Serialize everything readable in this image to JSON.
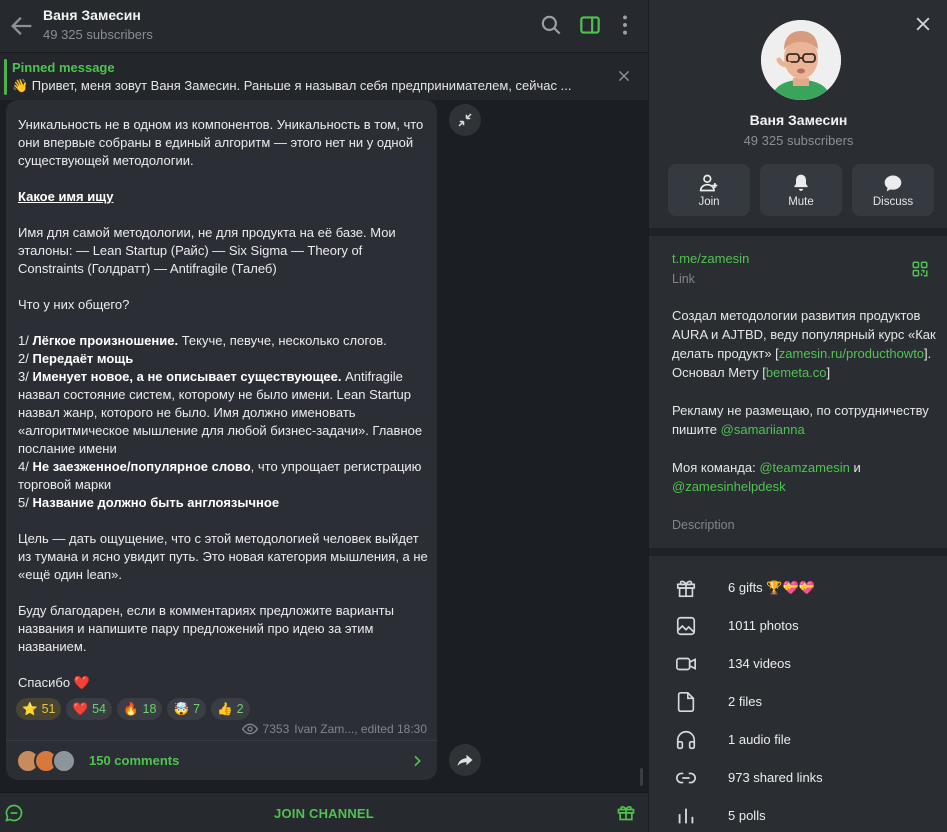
{
  "header": {
    "title": "Ваня Замесин",
    "subscribers": "49 325 subscribers"
  },
  "pinned": {
    "label": "Pinned message",
    "text": "👋 Привет, меня зовут Ваня Замесин. Раньше я называл себя предпринимателем, сейчас ..."
  },
  "message": {
    "p1": "Уникальность не в одном из компонентов. Уникальность в том, что они впервые собраны в единый алгоритм — этого нет ни у одной существующей методологии.",
    "h1": "Какое имя ищу",
    "p2": "Имя для самой методологии, не для продукта на её базе. Мои эталоны: — Lean Startup (Райс) — Six Sigma — Theory of Constraints (Голдратт) — Antifragile (Талеб)",
    "p3": "Что у них общего?",
    "l1a": "1/ ",
    "l1b": "Лёгкое произношение.",
    "l1c": " Текуче, певуче, несколько слогов.",
    "l2a": "2/ ",
    "l2b": "Передаёт мощь",
    "l3a": "3/ ",
    "l3b": "Именует новое, а не описывает существующее.",
    "l3c": " Antifragile назвал состояние систем, которому не было имени. Lean Startup назвал жанр, которого не было. Имя должно именовать «алгоритмическое мышление для любой бизнес-задачи». Главное послание имени",
    "l4a": "4/ ",
    "l4b": "Не заезженное/популярное слово",
    "l4c": ", что упрощает регистрацию торговой марки",
    "l5a": "5/ ",
    "l5b": "Название должно быть англоязычное",
    "p4": "Цель — дать ощущение, что с этой методологией человек выйдет из тумана и ясно увидит путь. Это новая категория мышления, а не «ещё один lean».",
    "p5": "Буду благодарен, если в комментариях предложите варианты названия и напишите пару предложений про идею за этим названием.",
    "p6": "Спасибо ❤️"
  },
  "reactions": [
    {
      "emoji": "⭐",
      "count": "51"
    },
    {
      "emoji": "❤️",
      "count": "54"
    },
    {
      "emoji": "🔥",
      "count": "18"
    },
    {
      "emoji": "🤯",
      "count": "7"
    },
    {
      "emoji": "👍",
      "count": "2"
    }
  ],
  "meta": {
    "views": "7353",
    "author_edit": "Ivan Zam..., edited 18:30"
  },
  "comments": {
    "label": "150 comments"
  },
  "join": {
    "label": "JOIN CHANNEL"
  },
  "info": {
    "name": "Ваня Замесин",
    "subscribers": "49 325 subscribers",
    "actions": [
      {
        "label": "Join",
        "icon": "add-user-icon"
      },
      {
        "label": "Mute",
        "icon": "bell-icon"
      },
      {
        "label": "Discuss",
        "icon": "chat-bubble-icon"
      }
    ],
    "link": "t.me/zamesin",
    "link_label": "Link",
    "desc_1": "Создал методологии развития продуктов AURA и AJTBD, веду популярный курс «Как делать продукт» [",
    "desc_link1": "zamesin.ru/producthowto",
    "desc_2": "]. Основал Мету [",
    "desc_link2": "bemeta.co",
    "desc_3": "]",
    "desc_4": "Рекламу не размещаю, по сотрудничеству пишите ",
    "desc_mention1": "@samariianna",
    "desc_5": "Моя команда: ",
    "desc_mention2": "@teamzamesin",
    "desc_6": " и ",
    "desc_mention3": "@zamesinhelpdesk",
    "desc_label": "Description",
    "media": [
      {
        "icon": "gift-icon",
        "label": "6 gifts 🏆💝💝"
      },
      {
        "icon": "photo-icon",
        "label": "1011 photos"
      },
      {
        "icon": "video-icon",
        "label": "134 videos"
      },
      {
        "icon": "file-icon",
        "label": "2 files"
      },
      {
        "icon": "headphones-icon",
        "label": "1 audio file"
      },
      {
        "icon": "link-icon",
        "label": "973 shared links"
      },
      {
        "icon": "poll-icon",
        "label": "5 polls"
      }
    ]
  },
  "colors": {
    "accent": "#4fc34f",
    "bubble": "#2b2f35",
    "panel": "#2a2e33"
  }
}
